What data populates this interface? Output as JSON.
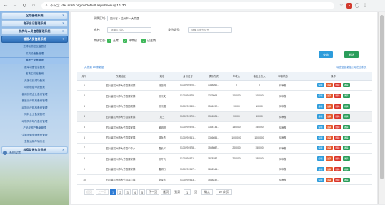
{
  "browser": {
    "insecure_label": "不安全",
    "url": "dwj.scahi.org.cn/Default.aspx#menu@10130"
  },
  "sidebar": {
    "groups": [
      {
        "label": "区划基础系统",
        "active": false
      },
      {
        "label": "电子出证管理系统",
        "active": false
      },
      {
        "label": "机构与人员信息管理系统",
        "active": false
      },
      {
        "label": "兽医人员信息系统",
        "active": true
      }
    ],
    "items": [
      "兰博动物卫医监督法",
      "机构设备备管理",
      "兽医产品备管理",
      "屠宰场备信息备案",
      "畜禽卫防疫备案",
      "无害化处理场备案",
      "动物检疫申报备案",
      "兽用处理企业备案管理",
      "兽医诊疗机构备案管理",
      "动物诊疗机构备案管理",
      "饲料企业备案管理",
      "动物饲养场所备案管理",
      "产品证照产备案管理",
      "生猪运输车辆备案管理",
      "生猪运输车辆行使"
    ],
    "active_item": 2,
    "bottom_group": "检疫监督执法系统",
    "system_link": "系统设置"
  },
  "filters": {
    "region_label": "所属区域:",
    "region_value": "四川省 > 达州市 > 大竹县",
    "name_label": "姓名:",
    "name_placeholder": "请输入姓名",
    "id_label": "身份证号:",
    "id_placeholder": "请输入身份证号",
    "status_label": "审核状态:",
    "statuses": [
      "正常",
      "待审核",
      "已注销"
    ]
  },
  "actions": {
    "query": "查询",
    "add": "新增"
  },
  "summary": "共找到 15 条数据",
  "export_links": "导出全部数据 | 导出当前页",
  "table": {
    "headers": [
      "序号",
      "所属地区",
      "姓名",
      "身份证号",
      "联系方式",
      "年收入",
      "兽医全收入",
      "审核状态",
      "操作"
    ],
    "rows": [
      [
        "1",
        "四川省达州市大竹县清河镇",
        "胡亚明",
        "5130291970...",
        "1388260...",
        "0",
        "0",
        "待审核"
      ],
      [
        "2",
        "四川省达州市大竹县周家镇",
        "张代文",
        "5130291975...",
        "1379563...",
        "100000",
        "100000",
        "待审核"
      ],
      [
        "3",
        "四川省达州市大竹县团坝镇",
        "张代国",
        "5130291980...",
        "1536192...",
        "10000",
        "10000",
        "待审核"
      ],
      [
        "4",
        "四川省达州市大竹县周家镇",
        "刘三",
        "5130291970...",
        "1396926...",
        "50000",
        "50000",
        "待审核"
      ],
      [
        "5",
        "四川省达州市大竹县周家镇",
        "朝明超",
        "5130291975...",
        "1354734...",
        "150000",
        "150000",
        "待审核"
      ],
      [
        "6",
        "四川省达州市大竹县周家镇",
        "邵永杰",
        "5130291961...",
        "1356656...",
        "1000000",
        "1000000",
        "待审核"
      ],
      [
        "7",
        "四川省达州市大竹县中华乡",
        "唐长义",
        "5130291978...",
        "1508087...",
        "200000",
        "150000",
        "待审核"
      ],
      [
        "8",
        "四川省达州市大竹县周家镇",
        "张开飞",
        "5130291971...",
        "1878287...",
        "200000",
        "180000",
        "待审核"
      ],
      [
        "9",
        "四川省达州市大竹县周家镇",
        "唐明行",
        "5130291967...",
        "1862344...",
        "",
        "",
        "待审核"
      ],
      [
        "10",
        "四川省达州市大竹县高穴镇",
        "李晓东",
        "5130291963...",
        "1558232...",
        "",
        "",
        "待审核"
      ]
    ],
    "ops": [
      "编辑",
      "注销",
      "删除",
      "详情"
    ]
  },
  "pager": {
    "first": "首页",
    "prev": "上一页",
    "pages": [
      "1",
      "2",
      "3",
      "4",
      "5"
    ],
    "next": "下一页",
    "last": "尾页",
    "jump_label": "到第",
    "jump_value": "1",
    "page_unit": "页",
    "go": "确定",
    "page_size": "10 条/页"
  },
  "colors": {
    "accent_blue": "#2d9cdb",
    "add_green": "#2a9d5a",
    "cancel_orange": "#e55a2b",
    "delete_red": "#d9342b"
  }
}
